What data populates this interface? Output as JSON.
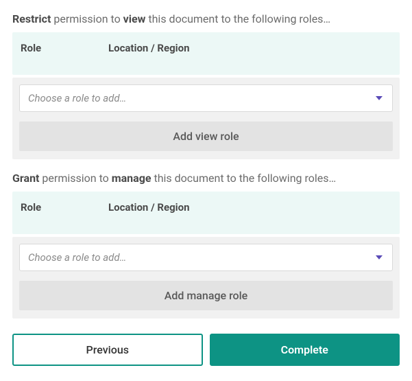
{
  "viewSection": {
    "title_html": "<strong>Restrict</strong> permission to <strong>view</strong> this document to the following roles…",
    "table": {
      "col_role": "Role",
      "col_loc": "Location / Region"
    },
    "select_placeholder": "Choose a role to add…",
    "add_button": "Add view role"
  },
  "manageSection": {
    "title_html": "<strong>Grant</strong> permission to <strong>manage</strong> this document to the following roles…",
    "table": {
      "col_role": "Role",
      "col_loc": "Location / Region"
    },
    "select_placeholder": "Choose a role to add…",
    "add_button": "Add manage role"
  },
  "footer": {
    "previous": "Previous",
    "complete": "Complete"
  }
}
